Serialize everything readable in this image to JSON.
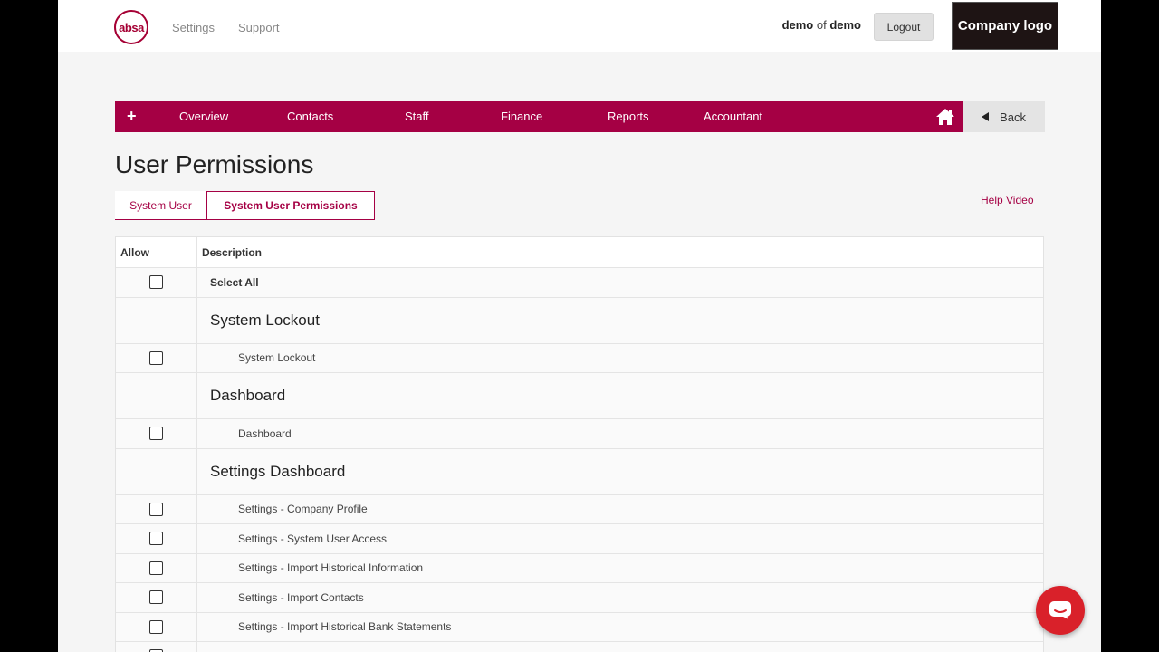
{
  "header": {
    "logo_text": "absa",
    "links": [
      "Settings",
      "Support"
    ],
    "user_name": "demo",
    "user_of": "of",
    "user_company": "demo",
    "logout_label": "Logout",
    "company_logo_label": "Company logo"
  },
  "nav": {
    "plus_label": "+",
    "items": [
      "Overview",
      "Contacts",
      "Staff",
      "Finance",
      "Reports",
      "Accountant"
    ],
    "back_label": "Back"
  },
  "page": {
    "title": "User Permissions",
    "tabs": [
      {
        "label": "System User",
        "active": false
      },
      {
        "label": "System User Permissions",
        "active": true
      }
    ],
    "help_video_label": "Help Video"
  },
  "table": {
    "columns": [
      "Allow",
      "Description"
    ],
    "select_all_label": "Select All",
    "sections": [
      {
        "title": "System Lockout",
        "items": [
          "System Lockout"
        ]
      },
      {
        "title": "Dashboard",
        "items": [
          "Dashboard"
        ]
      },
      {
        "title": "Settings Dashboard",
        "items": [
          "Settings - Company Profile",
          "Settings - System User Access",
          "Settings - Import Historical Information",
          "Settings - Import Contacts",
          "Settings - Import Historical Bank Statements"
        ]
      }
    ]
  },
  "colors": {
    "brand": "#a50044",
    "chat": "#d9212a"
  }
}
